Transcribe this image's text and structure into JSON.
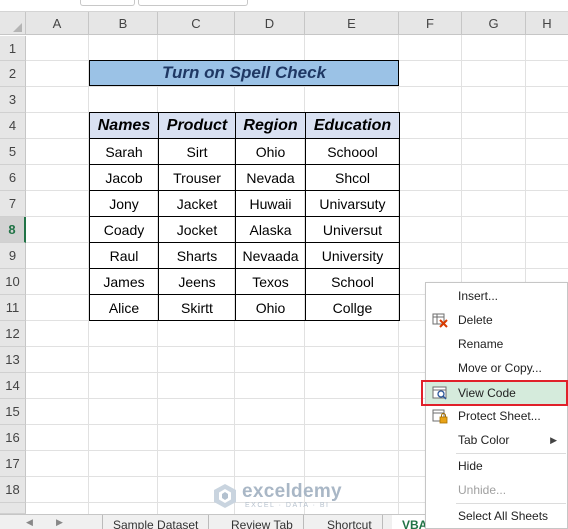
{
  "columns": [
    "A",
    "B",
    "C",
    "D",
    "E",
    "F",
    "G",
    "H"
  ],
  "rows": [
    "1",
    "2",
    "3",
    "4",
    "5",
    "6",
    "7",
    "8",
    "9",
    "10",
    "11",
    "12",
    "13",
    "14",
    "15",
    "16",
    "17",
    "18"
  ],
  "active_row": "8",
  "title": "Turn on Spell Check",
  "table": {
    "headers": [
      "Names",
      "Product",
      "Region",
      "Education"
    ],
    "rows": [
      [
        "Sarah",
        "Sirt",
        "Ohio",
        "Schoool"
      ],
      [
        "Jacob",
        "Trouser",
        "Nevada",
        "Shcol"
      ],
      [
        "Jony",
        "Jacket",
        "Huwaii",
        "Univarsuty"
      ],
      [
        "Coady",
        "Jocket",
        "Alaska",
        "Universut"
      ],
      [
        "Raul",
        "Sharts",
        "Nevaada",
        "University"
      ],
      [
        "James",
        "Jeens",
        "Texos",
        "School"
      ],
      [
        "Alice",
        "Skirtt",
        "Ohio",
        "Collge"
      ]
    ]
  },
  "context_menu": {
    "items": [
      {
        "label": "Insert...",
        "icon": "none"
      },
      {
        "label": "Delete",
        "icon": "delete-sheet-icon"
      },
      {
        "label": "Rename",
        "icon": "none"
      },
      {
        "label": "Move or Copy...",
        "icon": "none"
      },
      {
        "label": "View Code",
        "icon": "view-code-icon"
      },
      {
        "label": "Protect Sheet...",
        "icon": "protect-sheet-icon"
      },
      {
        "label": "Tab Color",
        "icon": "none"
      },
      {
        "label": "Hide",
        "icon": "none"
      },
      {
        "label": "Unhide...",
        "icon": "none"
      },
      {
        "label": "Select All Sheets",
        "icon": "none"
      }
    ],
    "highlighted": "View Code",
    "disabled": [
      "Unhide..."
    ]
  },
  "sheet_tabs": [
    "Sample Dataset",
    "Review Tab",
    "Shortcut",
    "VBA"
  ],
  "active_sheet": "VBA",
  "watermark": {
    "name": "exceldemy",
    "tagline": "EXCEL · DATA · BI"
  },
  "colors": {
    "excel_green": "#217346",
    "title_fill": "#9bc2e6",
    "header_fill": "#d9e1f2",
    "highlight_box": "#e0202a",
    "menu_highlight": "#d5ebdc"
  }
}
